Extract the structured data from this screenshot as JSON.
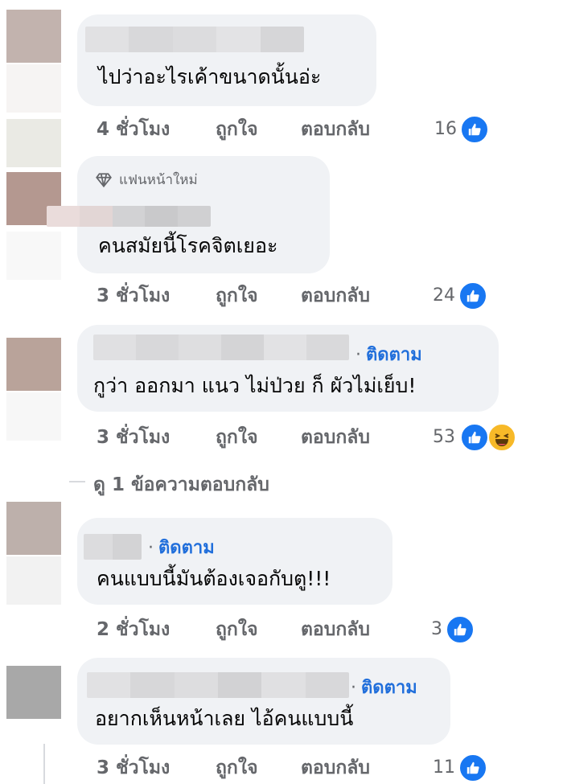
{
  "actions": {
    "like": "ถูกใจ",
    "reply": "ตอบกลับ"
  },
  "follow_label": "ติดตาม",
  "colors": {
    "like_blue": "#1877f2",
    "follow_blue": "#216fdb",
    "bubble": "#f0f2f5",
    "meta_gray": "#65676b",
    "haha_yellow": "#f7b928"
  },
  "comments": [
    {
      "text": "ไปว่าอะไรเค้าขนาดนั้นอ่ะ",
      "time": "4 ชั่วโมง",
      "reactions": "16",
      "reaction_icons": [
        "like-icon"
      ]
    },
    {
      "badge": "แฟนหน้าใหม่",
      "badge_icon": "diamond-icon",
      "text": "คนสมัยนี้โรคจิตเยอะ",
      "time": "3 ชั่วโมง",
      "reactions": "24",
      "reaction_icons": [
        "like-icon"
      ]
    },
    {
      "text": "กูว่า ออกมา แนว ไม่ป่วย ก็ ผัวไม่เย็บ!",
      "time": "3 ชั่วโมง",
      "reactions": "53",
      "reaction_icons": [
        "like-icon",
        "haha-icon"
      ],
      "follow": true
    },
    {
      "text": "คนแบบนี้มันต้องเจอกับตู!!!",
      "time": "2 ชั่วโมง",
      "reactions": "3",
      "reaction_icons": [
        "like-icon"
      ],
      "follow": true
    },
    {
      "text": "อยากเห็นหน้าเลย ไอ้คนแบบนี้",
      "time": "3 ชั่วโมง",
      "reactions": "11",
      "reaction_icons": [
        "like-icon"
      ],
      "follow": true
    }
  ],
  "view_replies": "ดู 1 ข้อความตอบกลับ"
}
